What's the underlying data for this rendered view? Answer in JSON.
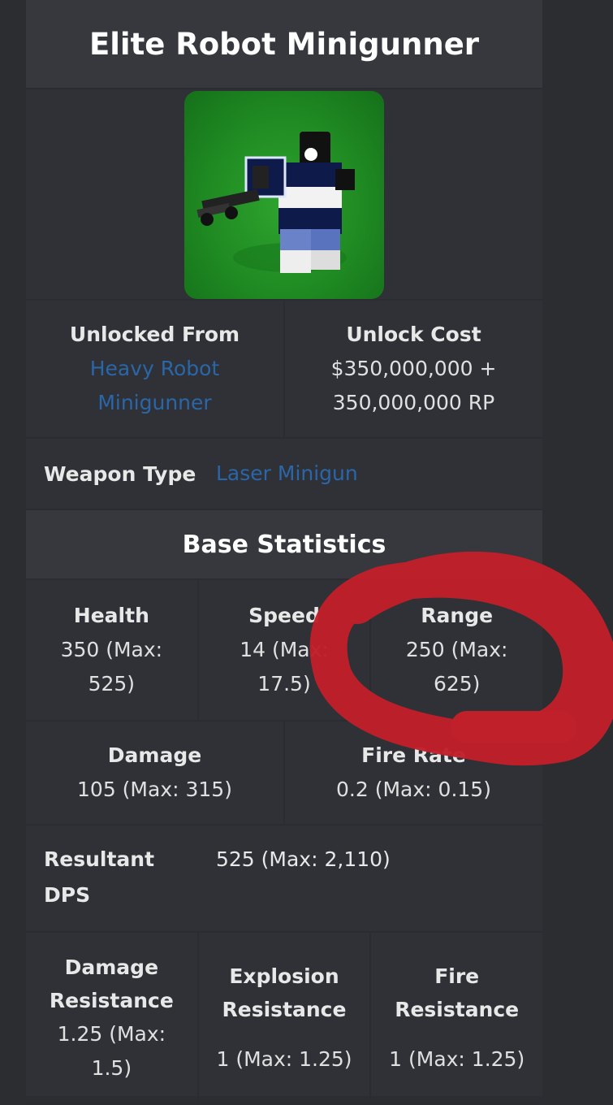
{
  "title": "Elite Robot Minigunner",
  "unlock": {
    "from_label": "Unlocked From",
    "from_link_line1": "Heavy Robot",
    "from_link_line2": "Minigunner",
    "cost_label": "Unlock Cost",
    "cost_line1": "$350,000,000 +",
    "cost_line2": "350,000,000 RP"
  },
  "weapon": {
    "label": "Weapon Type",
    "value": "Laser Minigun"
  },
  "base_stats": {
    "heading": "Base Statistics",
    "health_label": "Health",
    "health_line1": "350 (Max:",
    "health_line2": "525)",
    "speed_label": "Speed",
    "speed_line1": "14 (Max:",
    "speed_line2": "17.5)",
    "range_label": "Range",
    "range_line1": "250 (Max:",
    "range_line2": "625)",
    "damage_label": "Damage",
    "damage_value": "105 (Max: 315)",
    "firerate_label": "Fire Rate",
    "firerate_value": "0.2 (Max: 0.15)",
    "dps_label_line1": "Resultant",
    "dps_label_line2": "DPS",
    "dps_value": "525 (Max: 2,110)",
    "dmgres_label_line1": "Damage",
    "dmgres_label_line2": "Resistance",
    "dmgres_line1": "1.25 (Max:",
    "dmgres_line2": "1.5)",
    "expres_label_line1": "Explosion",
    "expres_label_line2": "Resistance",
    "expres_value": "1 (Max: 1.25)",
    "fireres_label_line1": "Fire",
    "fireres_label_line2": "Resistance",
    "fireres_value": "1 (Max: 1.25)"
  },
  "colors": {
    "background": "#2b2d31",
    "header": "#36383d",
    "link": "#2a66a8",
    "annotation": "#c0202a",
    "portrait_bg": "#1f8a22"
  },
  "icons": {
    "portrait": "robot-minigunner-portrait",
    "annotation": "red-circle-scribble"
  }
}
